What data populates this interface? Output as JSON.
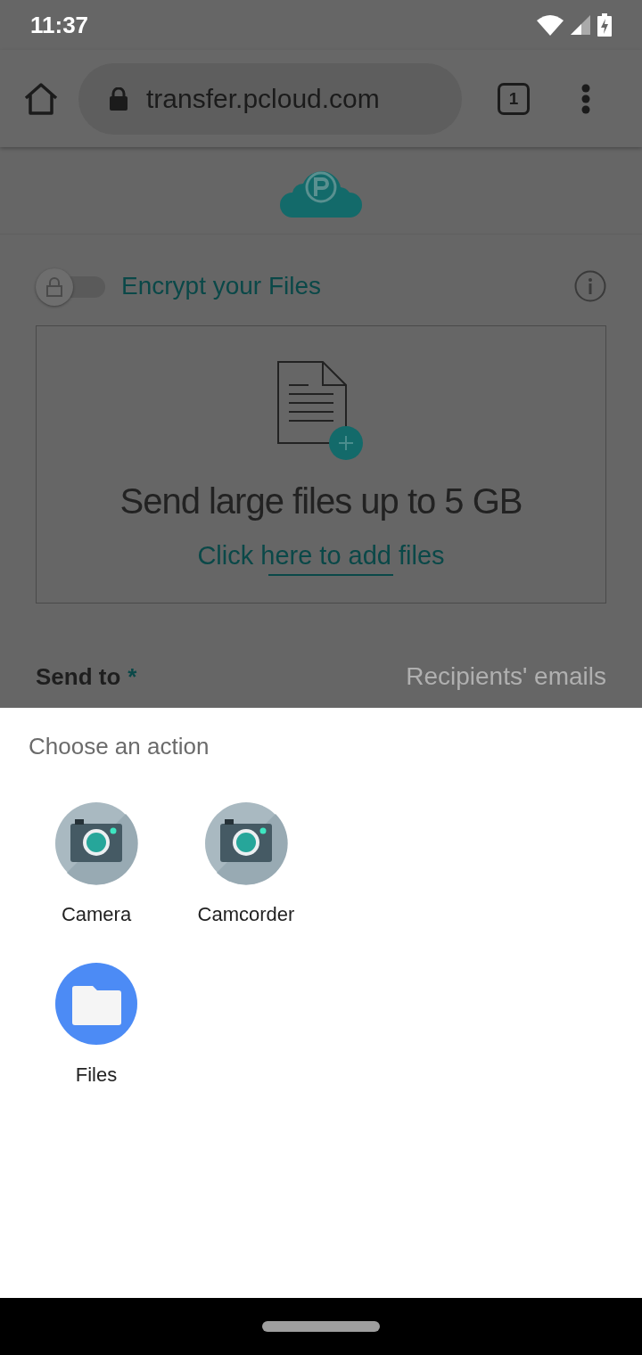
{
  "status_bar": {
    "time": "11:37"
  },
  "browser_toolbar": {
    "url": "transfer.pcloud.com",
    "tab_count": "1"
  },
  "encryption": {
    "label": "Encrypt your Files",
    "on": false
  },
  "upload_area": {
    "heading": "Send large files up to 5 GB",
    "link": "Click here to add files"
  },
  "send_to": {
    "label": "Send to",
    "required_mark": "*",
    "placeholder": "Recipients' emails"
  },
  "action_sheet": {
    "title": "Choose an action",
    "apps": [
      {
        "name": "Camera",
        "kind": "camera"
      },
      {
        "name": "Camcorder",
        "kind": "camera"
      },
      {
        "name": "Files",
        "kind": "files"
      }
    ]
  }
}
